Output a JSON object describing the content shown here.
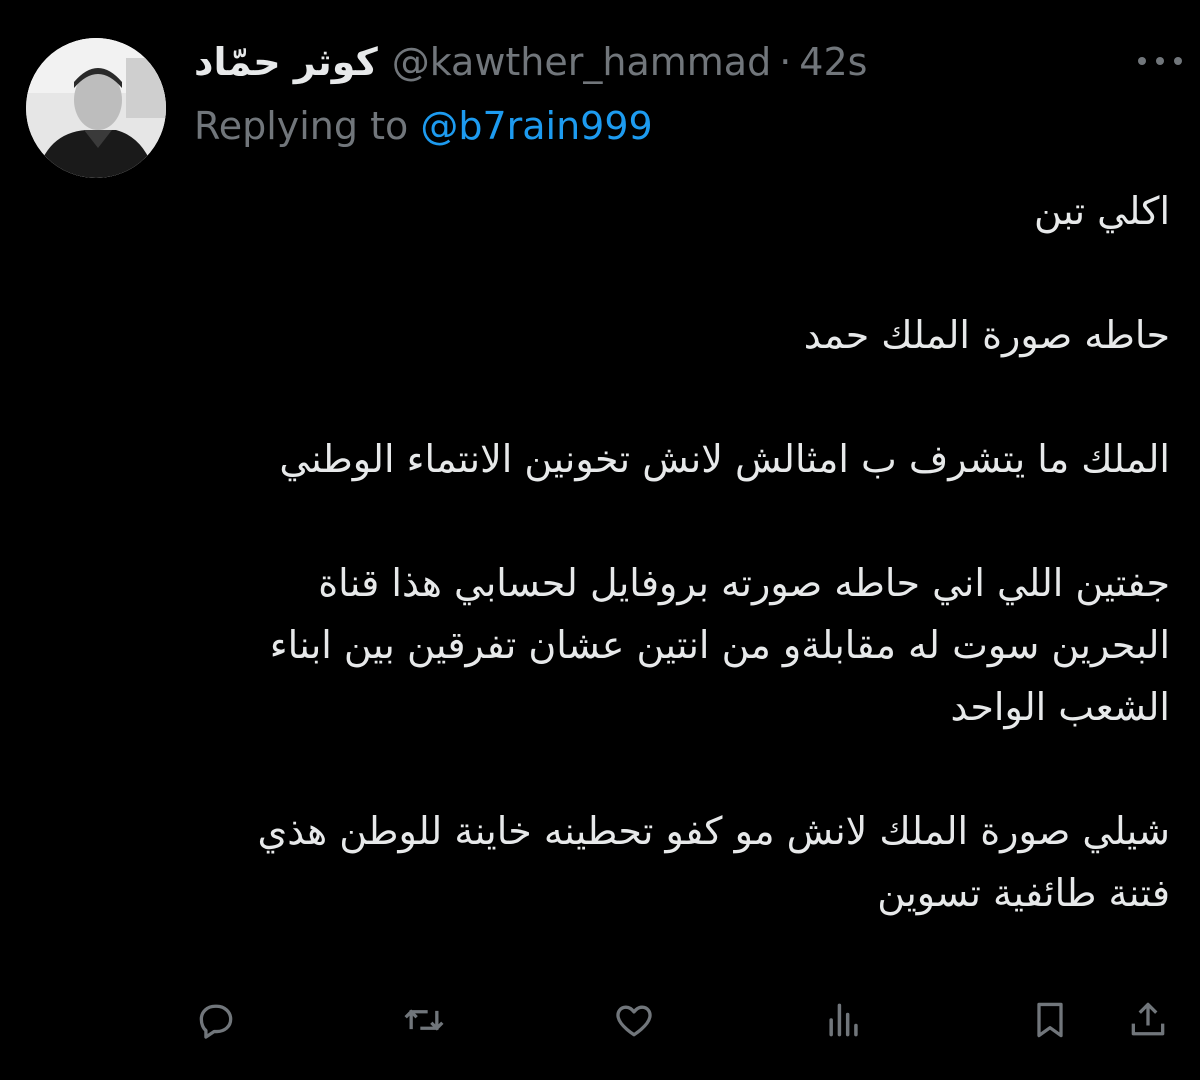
{
  "tweet": {
    "display_name": "كوثر حمّاد",
    "handle": "@kawther_hammad",
    "separator": "·",
    "timestamp": "42s",
    "replying_prefix": "Replying to",
    "replying_to": "@b7rain999",
    "paragraphs": [
      "اكلي تبن",
      "حاطه صورة الملك حمد",
      "الملك ما يتشرف ب امثالش لانش تخونين الانتماء الوطني",
      "جفتين اللي اني حاطه صورته بروفايل لحسابي هذا قناة البحرين سوت له مقابلةو من انتين عشان تفرقين بين ابناء الشعب الواحد",
      "شيلي صورة الملك لانش مو كفو تحطينه خاينة للوطن هذي فتنة طائفية تسوين"
    ]
  },
  "icons": {
    "more": "more-horizontal-icon",
    "reply": "reply-icon",
    "retweet": "retweet-icon",
    "like": "like-icon",
    "views": "views-icon",
    "bookmark": "bookmark-icon",
    "share": "share-icon"
  },
  "colors": {
    "background": "#000000",
    "text": "#e7e9ea",
    "secondary": "#71767b",
    "link": "#1d9bf0"
  }
}
